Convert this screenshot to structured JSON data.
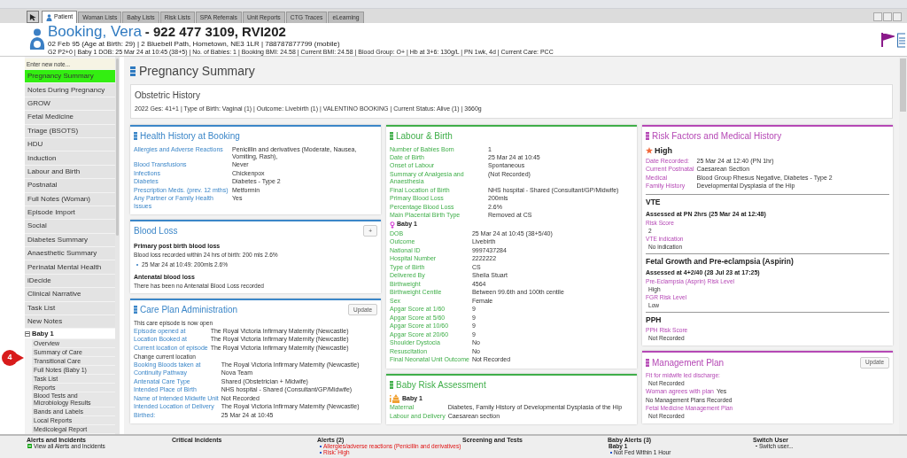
{
  "tabs": [
    {
      "label": "Patient",
      "selected": true
    },
    {
      "label": "Woman Lists",
      "selected": false
    },
    {
      "label": "Baby Lists",
      "selected": false
    },
    {
      "label": "Risk Lists",
      "selected": false
    },
    {
      "label": "SPA Referrals",
      "selected": false
    },
    {
      "label": "Unit Reports",
      "selected": false
    },
    {
      "label": "CTG Traces",
      "selected": false
    },
    {
      "label": "eLearning",
      "selected": false
    }
  ],
  "patient": {
    "name": "Booking, Vera",
    "identifiers": "- 922 477 3109, RVI202",
    "details": "02 Feb 95 (Age at Birth: 29) | 2 Bluebell Path, Hometown, NE3 1LR | 788787877799 (mobile)",
    "summary": "G2 P2+0 | Baby 1 DOB: 25 Mar 24 at 10:45 (38+5) | No. of Babies: 1 | Booking BMI: 24.58 | Current BMI: 24.58 | Blood Group: O+ | Hb at 3+6: 130g/L | PN 1wk, 4d | Current Care: PCC"
  },
  "sidebar": {
    "note_placeholder": "Enter new note...",
    "items": [
      {
        "label": "Pregnancy Summary",
        "selected": true
      },
      {
        "label": "Notes During Pregnancy",
        "selected": false
      },
      {
        "label": "GROW",
        "selected": false
      },
      {
        "label": "Fetal Medicine",
        "selected": false
      },
      {
        "label": "Triage (BSOTS)",
        "selected": false
      },
      {
        "label": "HDU",
        "selected": false
      },
      {
        "label": "Induction",
        "selected": false
      },
      {
        "label": "Labour and Birth",
        "selected": false
      },
      {
        "label": "Postnatal",
        "selected": false
      },
      {
        "label": "Full Notes (Woman)",
        "selected": false
      },
      {
        "label": "Episode Import",
        "selected": false
      },
      {
        "label": "Social",
        "selected": false
      },
      {
        "label": "Diabetes Summary",
        "selected": false
      },
      {
        "label": "Anaesthetic Summary",
        "selected": false
      },
      {
        "label": "Perinatal Mental Health",
        "selected": false
      },
      {
        "label": "iDecide",
        "selected": false
      },
      {
        "label": "Clinical Narrative",
        "selected": false
      },
      {
        "label": "Task List",
        "selected": false
      },
      {
        "label": "New Notes",
        "selected": false
      }
    ],
    "baby_group": {
      "label": "Baby 1",
      "expanded": true,
      "items": [
        "Overview",
        "Summary of Care",
        "Transitional Care",
        "Full Notes (Baby 1)",
        "Task List",
        "Reports",
        "Blood Tests and Microbiology Results",
        "Bands and Labels",
        "Local Reports",
        "Medicolegal Report"
      ]
    }
  },
  "callout": {
    "label": "4"
  },
  "page_title": "Pregnancy Summary",
  "obstetric_history": {
    "title": "Obstetric History",
    "summary": "2022  Ges: 41+1 | Type of Birth:  Vaginal (1) | Outcome:  Livebirth (1) | VALENTINO BOOKING | Current Status:  Alive (1) | 3660g"
  },
  "columns": [
    [
      {
        "title": "Health History at Booking",
        "color": "#3b86c8",
        "icon": true,
        "blocks": [
          {
            "kind": "field",
            "label": "Allergies and Adverse Reactions",
            "value": "Penicillin and derivatives (Moderate, Nausea, Vomiting, Rash),"
          },
          {
            "kind": "field",
            "label": "Blood Transfusions",
            "value": "Never"
          },
          {
            "kind": "field",
            "label": "Infections",
            "value": "Chickenpox"
          },
          {
            "kind": "field",
            "label": "Diabetes",
            "value": "Diabetes - Type 2"
          },
          {
            "kind": "field",
            "label": "Prescription Meds. (prev. 12 mths)",
            "value": "Metformin"
          },
          {
            "kind": "field",
            "label": "Any Partner or Family Health Issues",
            "value": "Yes"
          }
        ]
      },
      {
        "title": "Blood Loss",
        "color": "#3b86c8",
        "icon": false,
        "button": "+",
        "blocks": [
          {
            "kind": "subheading",
            "text": "Primary post birth blood loss"
          },
          {
            "kind": "text",
            "text": "Blood loss recorded within 24 hrs of birth: 200 mls 2.6%"
          },
          {
            "kind": "bullet",
            "text": "25 Mar 24 at 10:49: 200mls 2.6%"
          },
          {
            "kind": "subheading",
            "text": "Antenatal blood loss"
          },
          {
            "kind": "text",
            "text": "There has been no Antenatal Blood Loss recorded"
          }
        ]
      },
      {
        "title": "Care Plan Administration",
        "color": "#3b86c8",
        "icon": true,
        "button": "Update",
        "blocks": [
          {
            "kind": "text",
            "text": "This care episode is now open"
          },
          {
            "kind": "field",
            "label": "Episode opened at",
            "value": "The Royal Victoria Infirmary Maternity (Newcastle)"
          },
          {
            "kind": "field",
            "label": "Location Booked at",
            "value": "The Royal Victoria Infirmary Maternity (Newcastle)"
          },
          {
            "kind": "field",
            "label": "Current location of episode",
            "value": "The Royal Victoria Infirmary Maternity (Newcastle)"
          },
          {
            "kind": "text",
            "text": "Change current location"
          },
          {
            "kind": "field",
            "label": "Booking Bloods taken at",
            "value": "The Royal Victoria Infirmary Maternity (Newcastle)"
          },
          {
            "kind": "field",
            "label": "Continuity Pathway",
            "value": "Nova Team"
          },
          {
            "kind": "field",
            "label": "Antenatal Care Type",
            "value": "Shared (Obstetrician + Midwife)"
          },
          {
            "kind": "field",
            "label": "Intended Place of Birth",
            "value": "NHS hospital - Shared (Consultant/GP/Midwife)"
          },
          {
            "kind": "field",
            "label": "Name of Intended Midwife Unit",
            "value": "Not Recorded"
          },
          {
            "kind": "field",
            "label": "Intended Location of Delivery",
            "value": "The Royal Victoria Infirmary Maternity (Newcastle)"
          },
          {
            "kind": "field",
            "label": "Birthed:",
            "value": "25 Mar 24 at 10:45"
          }
        ]
      }
    ],
    [
      {
        "title": "Labour & Birth",
        "color": "#3fae49",
        "icon": true,
        "blocks": [
          {
            "kind": "field",
            "label": "Number of Babies Born",
            "value": "1"
          },
          {
            "kind": "field",
            "label": "Date of Birth",
            "value": "25 Mar 24 at 10:45"
          },
          {
            "kind": "field",
            "label": "Onset of Labour",
            "value": "Spontaneous"
          },
          {
            "kind": "field",
            "label": "Summary of Analgesia and Anaesthesia",
            "value": "(Not Recorded)"
          },
          {
            "kind": "field",
            "label": "Final Location of Birth",
            "value": "NHS hospital - Shared (Consultant/GP/Midwife)"
          },
          {
            "kind": "field",
            "label": "Primary Blood Loss",
            "value": "200mls"
          },
          {
            "kind": "field",
            "label": "Percentage Blood Loss",
            "value": "2.6%"
          },
          {
            "kind": "field",
            "label": "Main Placental Birth Type",
            "value": "Removed at CS"
          },
          {
            "kind": "baby",
            "text": "Baby 1"
          },
          {
            "kind": "field",
            "label": "DOB",
            "value": "25 Mar 24 at 10:45 (38+5/40)"
          },
          {
            "kind": "field",
            "label": "Outcome",
            "value": "Livebirth"
          },
          {
            "kind": "field",
            "label": "National ID",
            "value": "9997437284"
          },
          {
            "kind": "field",
            "label": "Hospital Number",
            "value": "2222222"
          },
          {
            "kind": "field",
            "label": "Type of Birth",
            "value": "CS"
          },
          {
            "kind": "field",
            "label": "Delivered By",
            "value": "Sheila Stuart"
          },
          {
            "kind": "field",
            "label": "Birthweight",
            "value": "4564"
          },
          {
            "kind": "field",
            "label": "Birthweight Centile",
            "value": "Between 99.6th and 100th centile"
          },
          {
            "kind": "field",
            "label": "Sex",
            "value": "Female"
          },
          {
            "kind": "field",
            "label": "Apgar Score at 1/60",
            "value": "9"
          },
          {
            "kind": "field",
            "label": "Apgar Score at 5/60",
            "value": "9"
          },
          {
            "kind": "field",
            "label": "Apgar Score at 10/60",
            "value": "9"
          },
          {
            "kind": "field",
            "label": "Apgar Score at 20/60",
            "value": "9"
          },
          {
            "kind": "field",
            "label": "Shoulder Dystocia",
            "value": "No"
          },
          {
            "kind": "field",
            "label": "Resuscitation",
            "value": "No"
          },
          {
            "kind": "field",
            "label": "Final Neonatal Unit Outcome",
            "value": "Not Recorded"
          }
        ]
      },
      {
        "title": "Baby Risk Assessment",
        "color": "#3fae49",
        "icon": true,
        "blocks": [
          {
            "kind": "risk_baby",
            "text": "Baby 1"
          },
          {
            "kind": "field",
            "label": "Maternal",
            "value": "Diabetes, Family History of Developmental Dysplasia of the Hip"
          },
          {
            "kind": "field",
            "label": "Labour and Delivery",
            "value": "Caesarean section"
          }
        ]
      }
    ],
    [
      {
        "title": "Risk Factors and Medical History",
        "color": "#b548b5",
        "icon": true,
        "blocks": [
          {
            "kind": "rating",
            "text": "High"
          },
          {
            "kind": "field",
            "label": "Date Recorded:",
            "value": "25 Mar 24 at 12:40 (PN 1hr)"
          },
          {
            "kind": "field",
            "label": "Current Postnatal",
            "value": "Caesarean Section"
          },
          {
            "kind": "field",
            "label": "Medical",
            "value": "Blood Group Rhesus Negative, Diabetes - Type 2"
          },
          {
            "kind": "field",
            "label": "Family History",
            "value": "Developmental Dysplasia of the Hip"
          },
          {
            "kind": "heading",
            "text": "VTE"
          },
          {
            "kind": "subheading",
            "text": "Assessed at PN 2hrs (25 Mar 24 at 12:48)"
          },
          {
            "kind": "stacked",
            "label": "Risk Score",
            "value": "2"
          },
          {
            "kind": "stacked",
            "label": "VTE indication",
            "value": "No indication"
          },
          {
            "kind": "heading",
            "text": "Fetal Growth and Pre-eclampsia (Aspirin)"
          },
          {
            "kind": "subheading",
            "text": "Assessed at 4+2/40 (28 Jul 23 at 17:25)"
          },
          {
            "kind": "stacked",
            "label": "Pre-Eclampsia (Asprin) Risk Level",
            "value": "High"
          },
          {
            "kind": "stacked",
            "label": "FGR Risk Level",
            "value": "Low"
          },
          {
            "kind": "heading",
            "text": "PPH"
          },
          {
            "kind": "stacked",
            "label": "PPH Risk Score",
            "value": "Not Recorded"
          }
        ]
      },
      {
        "title": "Management Plan",
        "color": "#b548b5",
        "icon": true,
        "button": "Update",
        "blocks": [
          {
            "kind": "stacked",
            "label": "Fit for midwife led discharge:",
            "value": "Not Recorded"
          },
          {
            "kind": "field",
            "label": "Woman agrees with plan",
            "value": "Yes"
          },
          {
            "kind": "text",
            "text": "No Management Plans Recorded"
          },
          {
            "kind": "stacked",
            "label": "Fetal Medicine Management Plan",
            "value": "Not Recorded"
          }
        ]
      }
    ]
  ],
  "bottom_bar": [
    {
      "title": "Alerts and Incidents",
      "items": [
        {
          "kind": "link",
          "text": "View all Alerts and Incidents"
        }
      ]
    },
    {
      "title": "Critical Incidents"
    },
    {
      "title": "Alerts (2)",
      "items": [
        {
          "kind": "alert",
          "text": "Allergies/adverse reactions (Penicillin and derivatives)"
        },
        {
          "kind": "alert",
          "text": "Risk: High"
        }
      ]
    },
    {
      "title": "Screening and Tests"
    },
    {
      "title": "Baby Alerts (3)",
      "items": [
        {
          "kind": "group",
          "text": "Baby 1"
        },
        {
          "kind": "bullet",
          "text": "Not Fed Within 1 Hour"
        }
      ]
    },
    {
      "title": "Switch User",
      "items": [
        {
          "kind": "action",
          "text": "Switch user..."
        }
      ]
    }
  ]
}
